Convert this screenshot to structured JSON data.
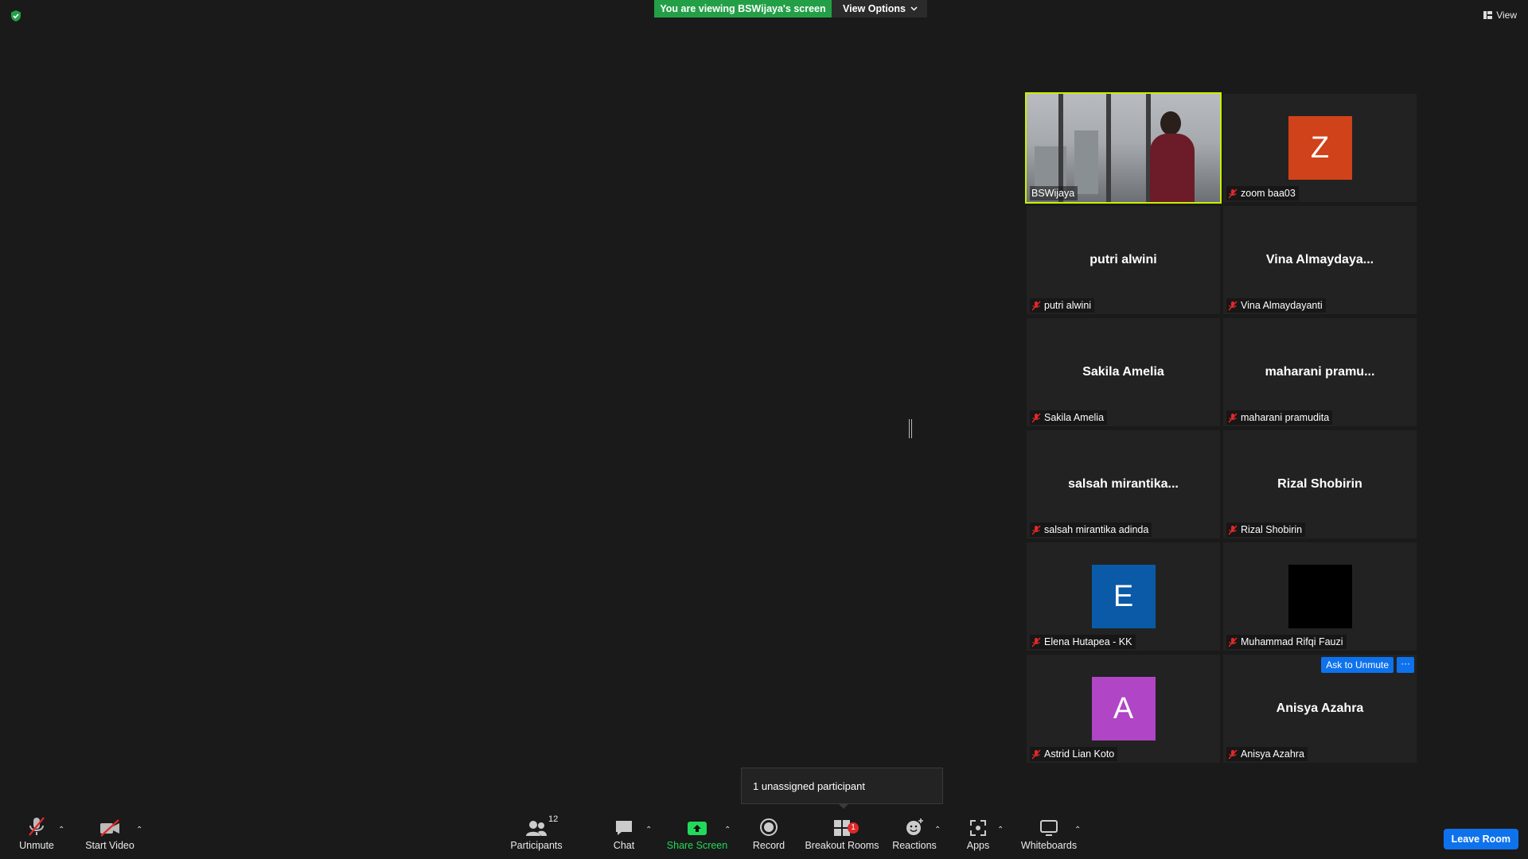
{
  "banner": {
    "viewing_text": "You are viewing BSWijaya's screen",
    "view_options_label": "View Options"
  },
  "view_button_label": "View",
  "gallery": {
    "tiles": [
      {
        "kind": "video",
        "label": "BSWijaya",
        "active": true
      },
      {
        "kind": "avatar",
        "avatar_letter": "Z",
        "avatar_color": "#d0421a",
        "label": "zoom baa03"
      },
      {
        "kind": "name",
        "display_name": "putri alwini",
        "label": "putri alwini"
      },
      {
        "kind": "name",
        "display_name": "Vina  Almaydaya...",
        "label": "Vina Almaydayanti"
      },
      {
        "kind": "name",
        "display_name": "Sakila Amelia",
        "label": "Sakila Amelia"
      },
      {
        "kind": "name",
        "display_name": "maharani  pramu...",
        "label": "maharani pramudita"
      },
      {
        "kind": "name",
        "display_name": "salsah  mirantika...",
        "label": "salsah mirantika adinda"
      },
      {
        "kind": "name",
        "display_name": "Rizal Shobirin",
        "label": "Rizal Shobirin"
      },
      {
        "kind": "avatar",
        "avatar_letter": "E",
        "avatar_color": "#0a5aa8",
        "label": "Elena Hutapea - KK"
      },
      {
        "kind": "avatar",
        "avatar_letter": "",
        "avatar_color": "#000000",
        "label": "Muhammad Rifqi Fauzi"
      },
      {
        "kind": "avatar",
        "avatar_letter": "A",
        "avatar_color": "#b045c5",
        "label": "Astrid Lian Koto"
      },
      {
        "kind": "name",
        "display_name": "Anisya Azahra",
        "label": "Anisya Azahra",
        "ask_unmute_label": "Ask to Unmute",
        "more_label": "···"
      }
    ]
  },
  "tooltip_text": "1 unassigned participant",
  "toolbar": {
    "unmute": "Unmute",
    "start_video": "Start Video",
    "participants": "Participants",
    "participants_count": "12",
    "chat": "Chat",
    "share_screen": "Share Screen",
    "record": "Record",
    "breakout_rooms": "Breakout Rooms",
    "breakout_badge": "1",
    "reactions": "Reactions",
    "apps": "Apps",
    "whiteboards": "Whiteboards",
    "leave_room": "Leave Room"
  },
  "colors": {
    "banner_green": "#23a047",
    "active_speaker_border": "#c9f000",
    "accent_blue": "#0e72ed",
    "muted_red": "#e02828",
    "share_green": "#23d959"
  }
}
